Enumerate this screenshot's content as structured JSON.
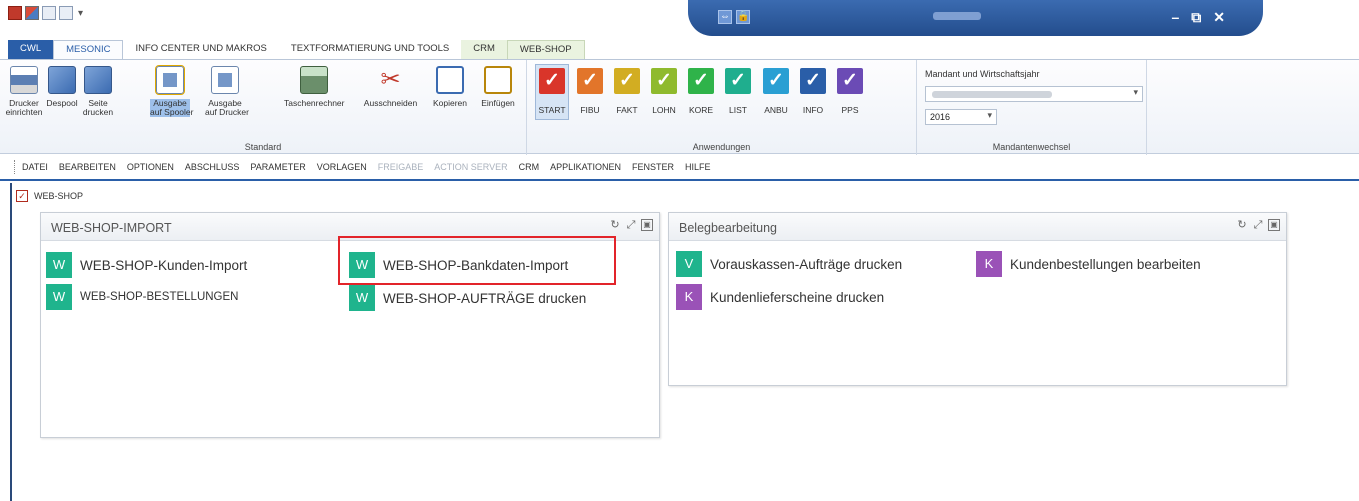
{
  "ribbon": {
    "tabs": [
      "CWL",
      "MESONIC",
      "INFO CENTER UND MAKROS",
      "TEXTFORMATIERUNG UND TOOLS",
      "CRM",
      "WEB-SHOP"
    ],
    "standard_group": {
      "label": "Standard",
      "buttons": [
        {
          "label1": "Drucker",
          "label2": "einrichten"
        },
        {
          "label1": "Despool",
          "label2": ""
        },
        {
          "label1": "Seite",
          "label2": "drucken"
        },
        {
          "label1": "Ausgabe",
          "label2": "auf Spooler"
        },
        {
          "label1": "Ausgabe",
          "label2": "auf Drucker"
        },
        {
          "label1": "Taschenrechner",
          "label2": ""
        },
        {
          "label1": "Ausschneiden",
          "label2": ""
        },
        {
          "label1": "Kopieren",
          "label2": ""
        },
        {
          "label1": "Einfügen",
          "label2": ""
        }
      ]
    },
    "apps_group": {
      "label": "Anwendungen",
      "apps": [
        {
          "label": "START",
          "color": "#d9352a"
        },
        {
          "label": "FIBU",
          "color": "#e2752a"
        },
        {
          "label": "FAKT",
          "color": "#d2ad22"
        },
        {
          "label": "LOHN",
          "color": "#8fba2e"
        },
        {
          "label": "KORE",
          "color": "#2fb34a"
        },
        {
          "label": "LIST",
          "color": "#1fae8e"
        },
        {
          "label": "ANBU",
          "color": "#2a9fd3"
        },
        {
          "label": "INFO",
          "color": "#2a5ea8"
        },
        {
          "label": "PPS",
          "color": "#6b4bb5"
        }
      ]
    },
    "mandant_group": {
      "title": "Mandant und Wirtschaftsjahr",
      "year": "2016",
      "label": "Mandantenwechsel"
    }
  },
  "menubar": {
    "items": [
      "DATEI",
      "BEARBEITEN",
      "OPTIONEN",
      "ABSCHLUSS",
      "PARAMETER",
      "VORLAGEN",
      "FREIGABE",
      "ACTION SERVER",
      "CRM",
      "APPLIKATIONEN",
      "FENSTER",
      "HILFE"
    ]
  },
  "document_tab": "WEB-SHOP",
  "panels": {
    "import": {
      "title": "WEB-SHOP-IMPORT",
      "tiles": [
        {
          "letter": "W",
          "label": "WEB-SHOP-Kunden-Import"
        },
        {
          "letter": "W",
          "label": "WEB-SHOP-BESTELLUNGEN"
        },
        {
          "letter": "W",
          "label": "WEB-SHOP-Bankdaten-Import"
        },
        {
          "letter": "W",
          "label": "WEB-SHOP-AUFTRÄGE drucken"
        }
      ]
    },
    "beleg": {
      "title": "Belegbearbeitung",
      "tiles": [
        {
          "letter": "V",
          "label": "Vorauskassen-Aufträge drucken"
        },
        {
          "letter": "K",
          "label": "Kundenlieferscheine drucken"
        },
        {
          "letter": "K",
          "label": "Kundenbestellungen bearbeiten"
        }
      ]
    }
  },
  "colors": {
    "accent": "#2a5ea8",
    "teal": "#1fb48d",
    "purple": "#9a52b7",
    "highlight": "#e2242a"
  }
}
